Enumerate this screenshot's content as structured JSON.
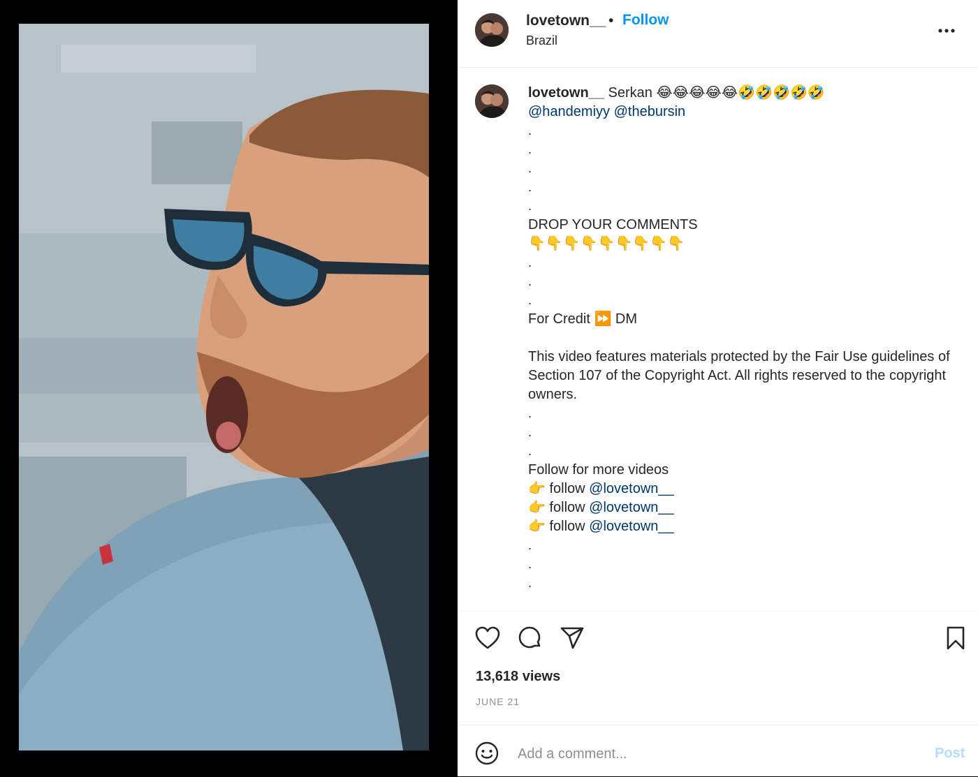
{
  "colors": {
    "accent": "#0095f6",
    "mention": "#00376b",
    "post_disabled": "#b2dffc",
    "muted": "#8e8e8e"
  },
  "header": {
    "username": "lovetown__",
    "separator": "•",
    "follow_label": "Follow",
    "location": "Brazil",
    "more_icon": "more-horizontal-icon"
  },
  "caption": {
    "username": "lovetown__",
    "text_lead": "Serkan 😂😂😂😂😂🤣🤣🤣🤣🤣",
    "mention_1": "@handemiyy",
    "mention_2": "@thebursin",
    "dot": ".",
    "drop_comments": "DROP YOUR COMMENTS",
    "pointing_down": "👇👇👇👇👇👇👇👇👇",
    "credit": "For Credit ⏩ DM",
    "fair_use": "This video features materials protected by the Fair Use guidelines of Section 107 of the Copyright Act. All rights reserved to the copyright owners.",
    "follow_more": "Follow for more videos",
    "follow_prefix": "👉 follow ",
    "follow_mention": "@lovetown__"
  },
  "actions": {
    "like_icon": "heart-icon",
    "comment_icon": "comment-icon",
    "share_icon": "share-icon",
    "save_icon": "bookmark-icon"
  },
  "stats": {
    "views": "13,618 views",
    "date": "JUNE 21"
  },
  "comment_box": {
    "placeholder": "Add a comment...",
    "post_label": "Post"
  }
}
